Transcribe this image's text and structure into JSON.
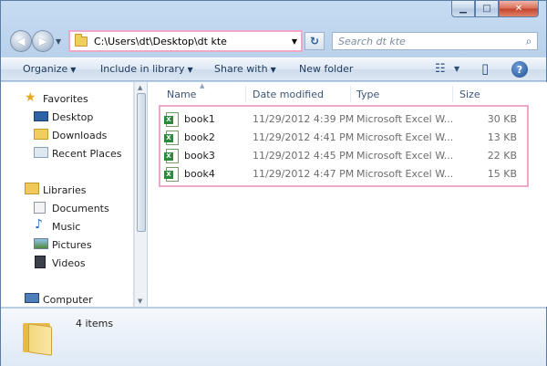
{
  "window": {
    "minimize_glyph": "▁",
    "maximize_glyph": "□",
    "close_glyph": "✕"
  },
  "nav": {
    "back_glyph": "◀",
    "forward_glyph": "▶",
    "recent_glyph": "▼",
    "address_path": "C:\\Users\\dt\\Desktop\\dt kte",
    "address_dropdown_glyph": "▼",
    "refresh_glyph": "↻",
    "search_placeholder": "Search dt kte",
    "search_icon_glyph": "⌕"
  },
  "toolbar": {
    "organize_label": "Organize",
    "include_label": "Include in library",
    "share_label": "Share with",
    "new_folder_label": "New folder",
    "caret": "▼",
    "views_glyph": "☷",
    "preview_glyph": "▯",
    "help_glyph": "?"
  },
  "sidebar": {
    "favorites_label": "Favorites",
    "favorites": [
      "Desktop",
      "Downloads",
      "Recent Places"
    ],
    "libraries_label": "Libraries",
    "libraries": [
      "Documents",
      "Music",
      "Pictures",
      "Videos"
    ],
    "computer_label": "Computer"
  },
  "filelist": {
    "columns": [
      "Name",
      "Date modified",
      "Type",
      "Size"
    ],
    "sort_glyph": "▲",
    "rows": [
      {
        "name": "book1",
        "date": "11/29/2012 4:39 PM",
        "type": "Microsoft Excel W...",
        "size": "30 KB"
      },
      {
        "name": "book2",
        "date": "11/29/2012 4:41 PM",
        "type": "Microsoft Excel W...",
        "size": "13 KB"
      },
      {
        "name": "book3",
        "date": "11/29/2012 4:45 PM",
        "type": "Microsoft Excel W...",
        "size": "22 KB"
      },
      {
        "name": "book4",
        "date": "11/29/2012 4:47 PM",
        "type": "Microsoft Excel W...",
        "size": "15 KB"
      }
    ]
  },
  "details": {
    "item_count": "4 items"
  },
  "colors": {
    "highlight_border": "#f0a8c8",
    "chrome_blue": "#b9d1ea",
    "excel_green": "#2c8a3c"
  }
}
